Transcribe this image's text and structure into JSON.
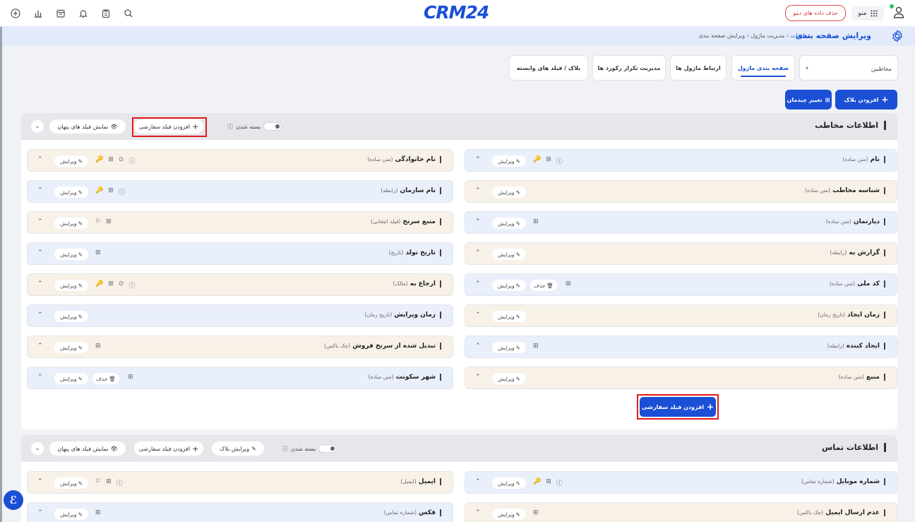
{
  "topbar": {
    "logo_text": "CRM24",
    "demo_button": "حذف داده های دمو",
    "menu_label": "منو"
  },
  "header": {
    "title": "ویرایش صفحه بندی",
    "breadcrumb": [
      "تنظیمات",
      "مدیریت ماژول",
      "ویرایش صفحه بندی"
    ]
  },
  "module_select": {
    "value": "مخاطبین"
  },
  "tabs": [
    {
      "label": "صفحه بندی ماژول",
      "active": true
    },
    {
      "label": "ارتباط ماژول ها",
      "active": false
    },
    {
      "label": "مدیریت تکرار رکورد ها",
      "active": false
    },
    {
      "label": "بلاک / فیلد های وابسته",
      "active": false
    }
  ],
  "actions": {
    "add_block": "افزودن بلاک",
    "change_layout": "تغییر چیدمان"
  },
  "section1": {
    "title": "اطلاعات مخاطب",
    "collapse_label": "بسته شدن",
    "add_custom": "افزودن فیلد سفارشی",
    "show_hidden": "نمایش فیلد های پنهان",
    "right_fields": [
      {
        "name": "نام",
        "type": "(متن ساده)",
        "color": "blue"
      },
      {
        "name": "شناسه مخاطب",
        "type": "(متن ساده)",
        "color": "beige"
      },
      {
        "name": "دپارتمان",
        "type": "(متن ساده)",
        "color": "blue"
      },
      {
        "name": "گزارش به",
        "type": "(رابطه)",
        "color": "beige"
      },
      {
        "name": "کد ملی",
        "type": "(متن ساده)",
        "color": "blue"
      },
      {
        "name": "زمان ایجاد",
        "type": "(تاریخ زمان)",
        "color": "beige"
      },
      {
        "name": "ایجاد کننده",
        "type": "(رابطه)",
        "color": "blue"
      },
      {
        "name": "منبع",
        "type": "(متن ساده)",
        "color": "beige"
      }
    ],
    "left_fields": [
      {
        "name": "نام خانوادگی",
        "type": "(متن ساده)",
        "color": "beige"
      },
      {
        "name": "نام سازمان",
        "type": "(رابطه)",
        "color": "blue"
      },
      {
        "name": "منبع سرنخ",
        "type": "(فیلد انتخابی)",
        "color": "beige"
      },
      {
        "name": "تاریخ تولد",
        "type": "(تاریخ)",
        "color": "blue"
      },
      {
        "name": "ارجاع به",
        "type": "(مالک)",
        "color": "beige"
      },
      {
        "name": "زمان ویرایش",
        "type": "(تاریخ زمان)",
        "color": "blue"
      },
      {
        "name": "تبدیل شده از سرنخ فروش",
        "type": "(چک باکس)",
        "color": "beige"
      },
      {
        "name": "شهر سکونت",
        "type": "(متن ساده)",
        "color": "blue"
      }
    ],
    "bottom_add": "افزودن فیلد سفارشی"
  },
  "section2": {
    "title": "اطلاعات تماس",
    "collapse_label": "بسته شدن",
    "edit_block": "ویرایش بلاک",
    "add_custom": "افزودن فیلد سفارشی",
    "show_hidden": "نمایش فیلد های پنهان",
    "right_fields": [
      {
        "name": "شماره موبایل",
        "type": "(شماره تماس)",
        "color": "blue"
      },
      {
        "name": "عدم ارسال ایمیل",
        "type": "(چک باکس)",
        "color": "beige"
      }
    ],
    "left_fields": [
      {
        "name": "ایمیل",
        "type": "(ایمیل)",
        "color": "beige"
      },
      {
        "name": "فکس",
        "type": "(شماره تماس)",
        "color": "blue"
      }
    ]
  },
  "field_actions": {
    "edit": "ویرایش",
    "delete": "حذف"
  }
}
